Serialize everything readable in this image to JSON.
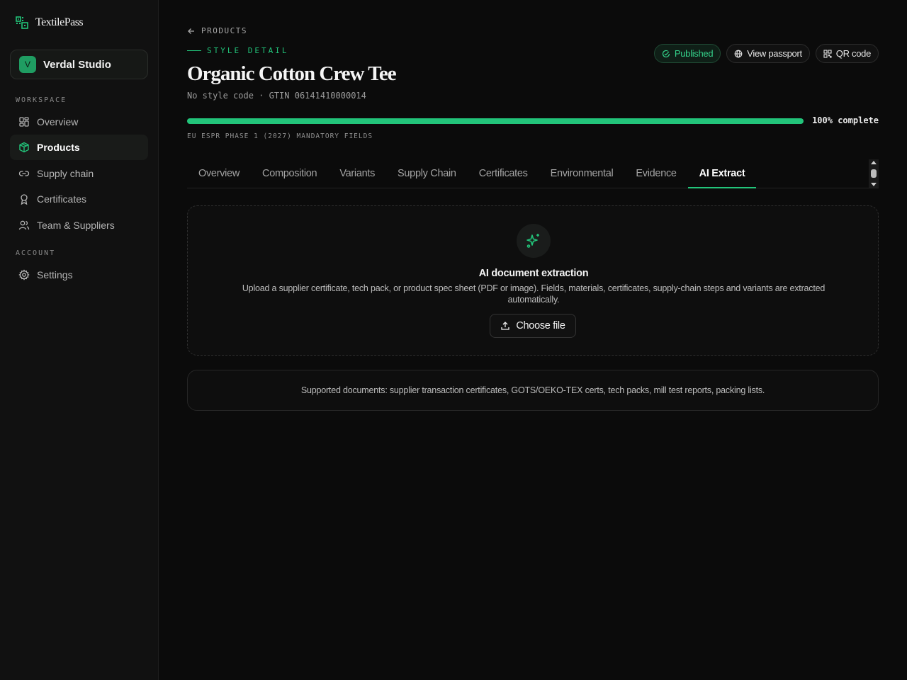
{
  "app": {
    "name": "TextilePass"
  },
  "org": {
    "initial": "V",
    "name": "Verdal Studio"
  },
  "sidebar": {
    "workspace_label": "WORKSPACE",
    "account_label": "ACCOUNT",
    "items": [
      {
        "label": "Overview",
        "icon": "grid-icon"
      },
      {
        "label": "Products",
        "icon": "box-icon",
        "active": true
      },
      {
        "label": "Supply chain",
        "icon": "link-icon"
      },
      {
        "label": "Certificates",
        "icon": "award-icon"
      },
      {
        "label": "Team & Suppliers",
        "icon": "users-icon"
      }
    ],
    "account_items": [
      {
        "label": "Settings",
        "icon": "gear-icon"
      }
    ]
  },
  "header": {
    "breadcrumb": "PRODUCTS",
    "eyebrow": "STYLE DETAIL",
    "title": "Organic Cotton Crew Tee",
    "meta": "No style code · GTIN 06141410000014",
    "status": "Published",
    "view_passport": "View passport",
    "qr_code": "QR code"
  },
  "progress": {
    "value": 1.0,
    "label": "100% complete",
    "caption": "EU ESPR PHASE 1 (2027) MANDATORY FIELDS"
  },
  "tabs": [
    "Overview",
    "Composition",
    "Variants",
    "Supply Chain",
    "Certificates",
    "Environmental",
    "Evidence",
    "AI Extract"
  ],
  "active_tab": "AI Extract",
  "extract": {
    "title": "AI document extraction",
    "description": "Upload a supplier certificate, tech pack, or product spec sheet (PDF or image). Fields, materials, certificates, supply-chain steps and variants are extracted automatically.",
    "button": "Choose file"
  },
  "supported": "Supported documents: supplier transaction certificates, GOTS/OEKO-TEX certs, tech packs, mill test reports, packing lists.",
  "colors": {
    "accent": "#22c47a",
    "background": "#0b0b0b",
    "sidebar": "#111111"
  }
}
